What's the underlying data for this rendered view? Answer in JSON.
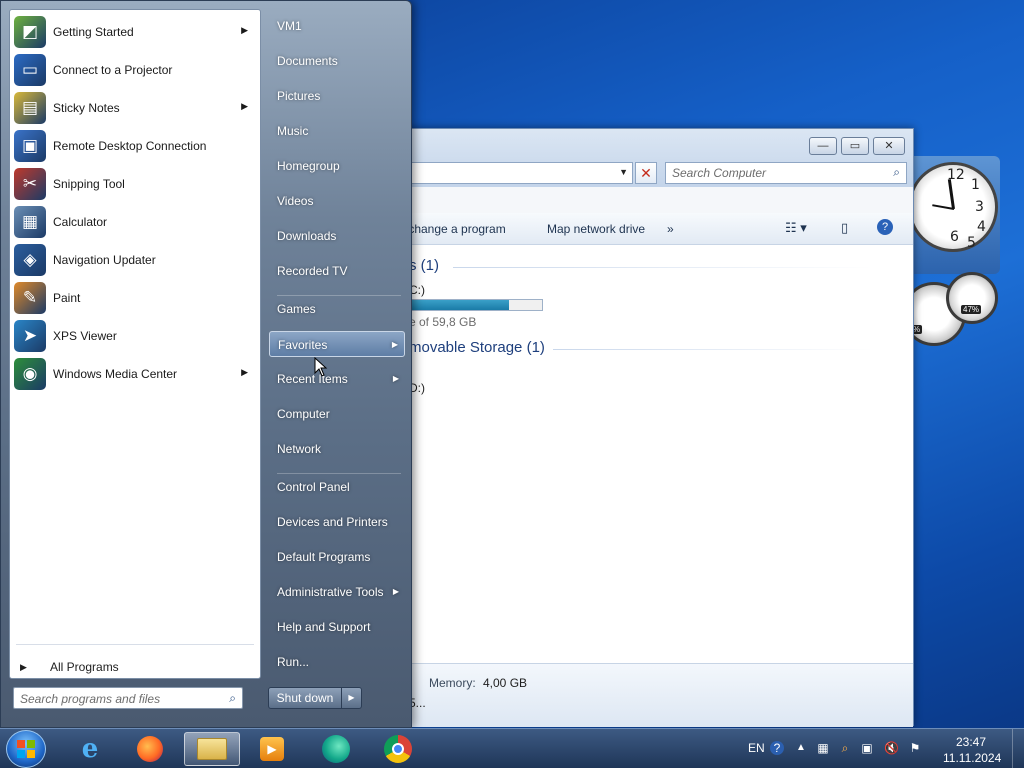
{
  "explorer": {
    "search_placeholder": "Search Computer",
    "toolbar": {
      "uninstall": "r change a program",
      "map_drive": "Map network drive",
      "more": "»"
    },
    "groups": {
      "hard_disks": "s (1)",
      "removable": "movable Storage (1)"
    },
    "drive_c": {
      "label": "C:)",
      "free_text": "e of 59,8 GB",
      "used_fraction": 0.78
    },
    "drive_d": {
      "label": "D:)"
    },
    "details": {
      "memory_label": "Memory:",
      "memory_value": "4,00 GB",
      "processor_fragment": "5..."
    },
    "window_buttons": {
      "minimize": "—",
      "maximize": "▭",
      "close": "✕"
    }
  },
  "start_menu": {
    "programs": [
      {
        "label": "Getting Started",
        "icon": "getting-started-icon",
        "submenu": true
      },
      {
        "label": "Connect to a Projector",
        "icon": "projector-icon",
        "submenu": false
      },
      {
        "label": "Sticky Notes",
        "icon": "sticky-notes-icon",
        "submenu": true
      },
      {
        "label": "Remote Desktop Connection",
        "icon": "remote-desktop-icon",
        "submenu": false
      },
      {
        "label": "Snipping Tool",
        "icon": "snipping-tool-icon",
        "submenu": false
      },
      {
        "label": "Calculator",
        "icon": "calculator-icon",
        "submenu": false
      },
      {
        "label": "Navigation Updater",
        "icon": "navigation-updater-icon",
        "submenu": false
      },
      {
        "label": "Paint",
        "icon": "paint-icon",
        "submenu": false
      },
      {
        "label": "XPS Viewer",
        "icon": "xps-viewer-icon",
        "submenu": false
      },
      {
        "label": "Windows Media Center",
        "icon": "media-center-icon",
        "submenu": true
      }
    ],
    "all_programs": "All Programs",
    "search_placeholder": "Search programs and files",
    "right_items": [
      {
        "label": "VM1",
        "submenu": false,
        "highlighted": false
      },
      {
        "label": "Documents",
        "submenu": false,
        "highlighted": false
      },
      {
        "label": "Pictures",
        "submenu": false,
        "highlighted": false
      },
      {
        "label": "Music",
        "submenu": false,
        "highlighted": false
      },
      {
        "label": "Homegroup",
        "submenu": false,
        "highlighted": false
      },
      {
        "label": "Videos",
        "submenu": false,
        "highlighted": false
      },
      {
        "label": "Downloads",
        "submenu": false,
        "highlighted": false
      },
      {
        "label": "Recorded TV",
        "submenu": false,
        "highlighted": false
      },
      {
        "label": "Games",
        "submenu": false,
        "highlighted": false
      },
      {
        "label": "Favorites",
        "submenu": true,
        "highlighted": true
      },
      {
        "label": "Recent Items",
        "submenu": true,
        "highlighted": false
      },
      {
        "label": "Computer",
        "submenu": false,
        "highlighted": false
      },
      {
        "label": "Network",
        "submenu": false,
        "highlighted": false
      },
      {
        "label": "Control Panel",
        "submenu": false,
        "highlighted": false
      },
      {
        "label": "Devices and Printers",
        "submenu": false,
        "highlighted": false
      },
      {
        "label": "Default Programs",
        "submenu": false,
        "highlighted": false
      },
      {
        "label": "Administrative Tools",
        "submenu": true,
        "highlighted": false
      },
      {
        "label": "Help and Support",
        "submenu": false,
        "highlighted": false
      },
      {
        "label": "Run...",
        "submenu": false,
        "highlighted": false
      }
    ],
    "shutdown": "Shut down"
  },
  "gadgets": {
    "cpu_percent": "47%",
    "ram_fragment": "%"
  },
  "taskbar": {
    "apps": [
      "internet-explorer-icon",
      "firefox-icon",
      "windows-explorer-icon",
      "media-player-icon",
      "edge-icon",
      "chrome-icon"
    ],
    "language": "EN",
    "time": "23:47",
    "date": "11.11.2024"
  }
}
